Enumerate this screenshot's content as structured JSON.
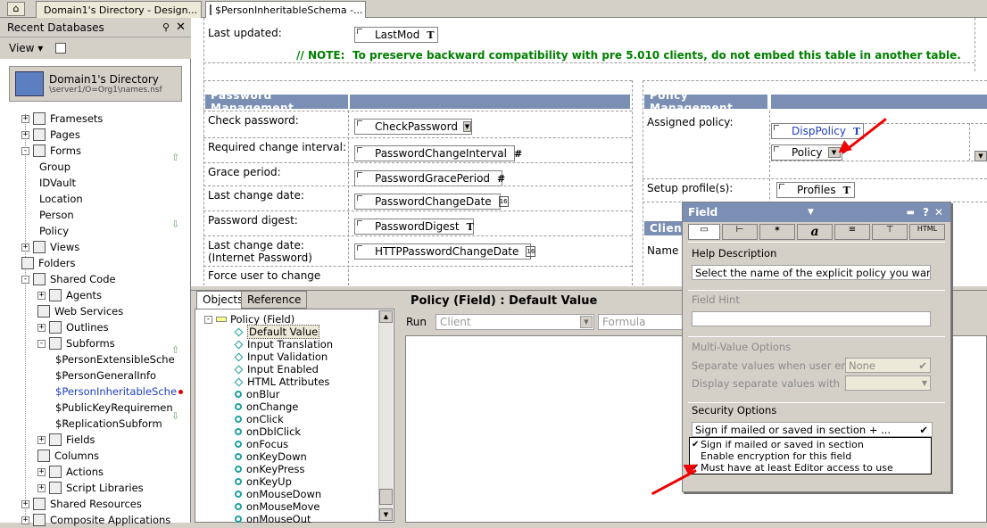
{
  "tabs": [
    {
      "label": "Domain1's Directory - Design..."
    },
    {
      "label": "$PersonInheritableSchema -..."
    }
  ],
  "left_panel": {
    "title": "Recent Databases",
    "view_label": "View ▾",
    "db_name": "Domain1's Directory",
    "db_path": "\\server1/O=Org1\\names.nsf",
    "tree": [
      {
        "label": "Framesets"
      },
      {
        "label": "Pages"
      },
      {
        "label": "Forms"
      },
      {
        "label": "Group"
      },
      {
        "label": "IDVault"
      },
      {
        "label": "Location"
      },
      {
        "label": "Person"
      },
      {
        "label": "Policy"
      },
      {
        "label": "Views"
      },
      {
        "label": "Folders"
      },
      {
        "label": "Shared Code"
      },
      {
        "label": "Agents"
      },
      {
        "label": "Web Services"
      },
      {
        "label": "Outlines"
      },
      {
        "label": "Subforms"
      },
      {
        "label": "$PersonExtensibleSche"
      },
      {
        "label": "$PersonGeneralInfo"
      },
      {
        "label": "$PersonInheritableSche"
      },
      {
        "label": "$PublicKeyRequiremen"
      },
      {
        "label": "$ReplicationSubform"
      },
      {
        "label": "Fields"
      },
      {
        "label": "Columns"
      },
      {
        "label": "Actions"
      },
      {
        "label": "Script Libraries"
      },
      {
        "label": "Shared Resources"
      },
      {
        "label": "Composite Applications"
      }
    ]
  },
  "design": {
    "last_updated_label": "Last updated:",
    "last_mod_field": "LastMod",
    "note_prefix": "// NOTE:",
    "note_text": "To preserve backward compatibility with pre 5.010 clients, do not embed this table in another table.",
    "password_header": "Password Management",
    "policy_header": "Policy Management",
    "client_header": "Clien",
    "rows": [
      {
        "label": "Check password:",
        "field": "CheckPassword"
      },
      {
        "label": "Required change interval:",
        "field": "PasswordChangeInterval"
      },
      {
        "label": "Grace period:",
        "field": "PasswordGracePeriod"
      },
      {
        "label": "Last change date:",
        "field": "PasswordChangeDate"
      },
      {
        "label": "Password digest:",
        "field": "PasswordDigest"
      },
      {
        "label": "Last change date:",
        "label2": "(Internet Password)",
        "field": "HTTPPasswordChangeDate"
      },
      {
        "label": "Force user to change"
      }
    ],
    "assigned_policy_label": "Assigned policy:",
    "disp_policy_field": "DispPolicy",
    "policy_field": "Policy",
    "setup_profile_label": "Setup profile(s):",
    "profiles_field": "Profiles",
    "name_label": "Name"
  },
  "objects": {
    "tab_objects": "Objects",
    "tab_reference": "Reference",
    "root": "Policy (Field)",
    "items": [
      "Default Value",
      "Input Translation",
      "Input Validation",
      "Input Enabled",
      "HTML Attributes",
      "onBlur",
      "onChange",
      "onClick",
      "onDblClick",
      "onFocus",
      "onKeyDown",
      "onKeyPress",
      "onKeyUp",
      "onMouseDown",
      "onMouseMove",
      "onMouseOut"
    ]
  },
  "editor": {
    "title": "Policy (Field) : Default Value",
    "run_label": "Run",
    "run_value": "Client",
    "lang_value": "Formula"
  },
  "properties": {
    "title": "Field",
    "help_label": "Help Description",
    "help_value": "Select the name of the explicit policy you want to assign",
    "hint_label": "Field Hint",
    "multi_label": "Multi-Value Options",
    "sep_enter_label": "Separate values when user enters",
    "sep_enter_value": "None",
    "sep_display_label": "Display separate values with",
    "security_label": "Security Options",
    "security_value": "Sign if mailed or saved in section + ...",
    "security_options": [
      {
        "label": "Sign if mailed or saved in section",
        "checked": "✔"
      },
      {
        "label": "Enable encryption for this field",
        "checked": ""
      },
      {
        "label": "Must have at least Editor access to use",
        "checked": "✔"
      }
    ]
  },
  "colors": {
    "accent": "#7b8fb4",
    "note": "#008000",
    "arrow": "#e00000"
  }
}
